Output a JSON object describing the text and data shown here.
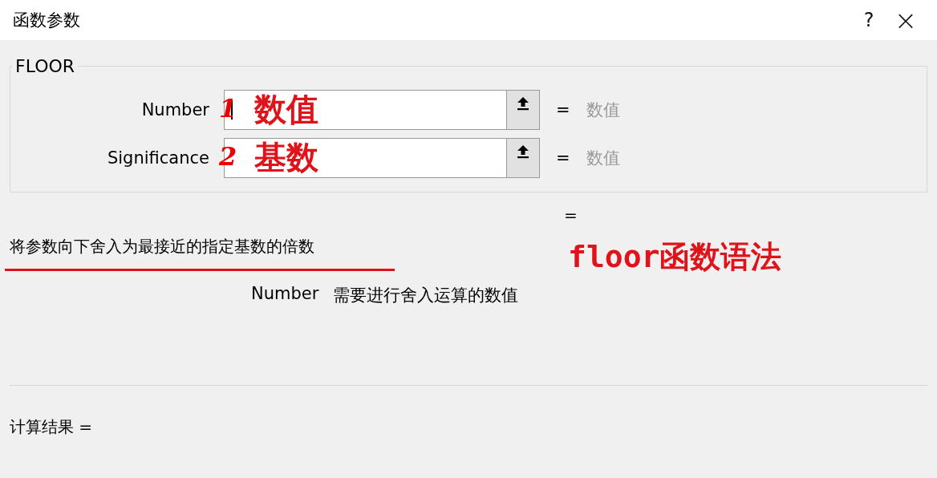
{
  "window": {
    "title": "函数参数",
    "help": "?",
    "close": "×"
  },
  "function_name": "FLOOR",
  "arguments": [
    {
      "label": "Number",
      "equals": "=",
      "result": "数值",
      "annotation_mark": "1",
      "annotation": "数值"
    },
    {
      "label": "Significance",
      "equals": "=",
      "result": "数值",
      "annotation_mark": "2",
      "annotation": "基数"
    }
  ],
  "function_result_equals": "=",
  "description": "将参数向下舍入为最接近的指定基数的倍数",
  "annotation_title": "floor函数语法",
  "argument_help": {
    "name": "Number",
    "text": "需要进行舍入运算的数值"
  },
  "formula_result": "计算结果 ="
}
